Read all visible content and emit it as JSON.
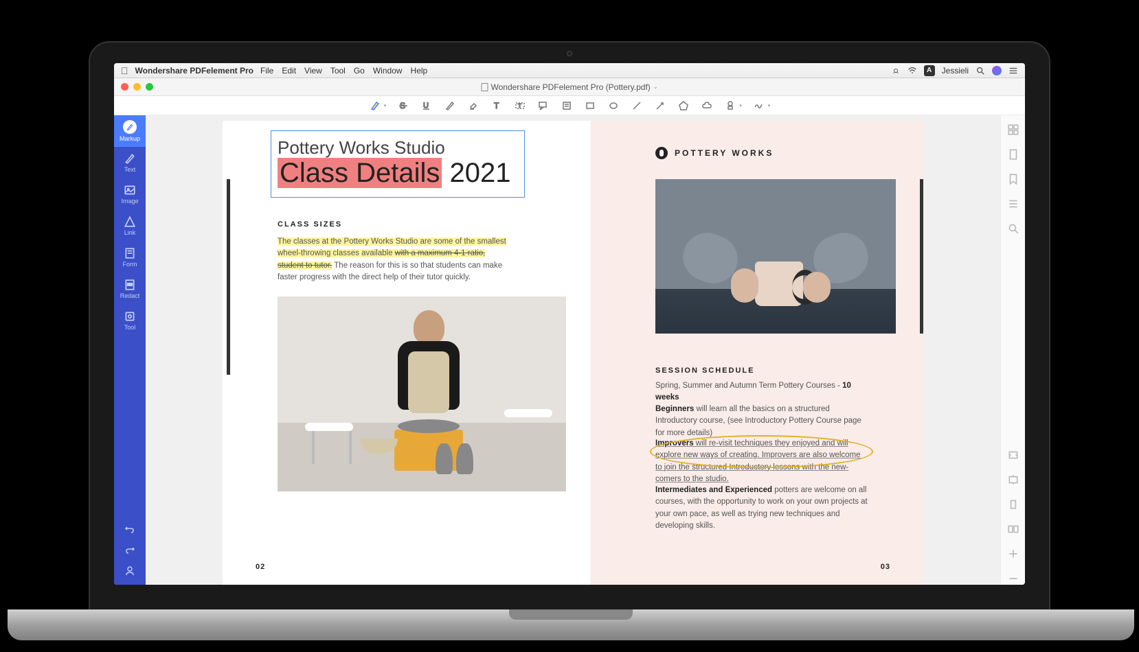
{
  "menubar": {
    "app": "Wondershare PDFelement Pro",
    "items": [
      "File",
      "Edit",
      "View",
      "Tool",
      "Go",
      "Window",
      "Help"
    ],
    "user": "Jessieli",
    "lang": "A"
  },
  "titlebar": {
    "title": "Wondershare PDFelement Pro (Pottery.pdf)"
  },
  "sidebar": {
    "items": [
      {
        "label": "Markup"
      },
      {
        "label": "Text"
      },
      {
        "label": "Image"
      },
      {
        "label": "Link"
      },
      {
        "label": "Form"
      },
      {
        "label": "Redact"
      },
      {
        "label": "Tool"
      }
    ]
  },
  "doc": {
    "h1": "Pottery Works Studio",
    "h2_a": "Class Details",
    "h2_b": " 2021",
    "class_sizes": "CLASS SIZES",
    "para_hl1": "The classes at the Pottery Works Studio are some of the smallest wheel-throwing classes available ",
    "para_strike": "with a maximum 4-1 ratio, student to tutor.",
    "para_rest": " The reason for this is so that students can make faster progress with the direct help of their tutor quickly.",
    "brand": "POTTERY WORKS",
    "sess_title": "SESSION SCHEDULE",
    "sess1_a": "Spring, Summer and Autumn Term Pottery Courses - ",
    "sess1_b": "10 weeks",
    "beg_bold": "Beginners",
    "beg_rest": " will learn all the basics on a structured Introductory course, (see Introductory Pottery Course page for more details)",
    "imp_bold": "Improvers",
    "imp_rest": " will re-visit techniques they enjoyed and will explore new ways of creating. Improvers are also welcome to join the structured Introductory lessons with the new-comers to the studio.",
    "int_bold": "Intermediates and Experienced",
    "int_rest": " potters are welcome on all courses, with the opportunity to work on your own projects at your own pace, as well as trying new techniques and developing skills.",
    "page_l": "02",
    "page_r": "03"
  }
}
